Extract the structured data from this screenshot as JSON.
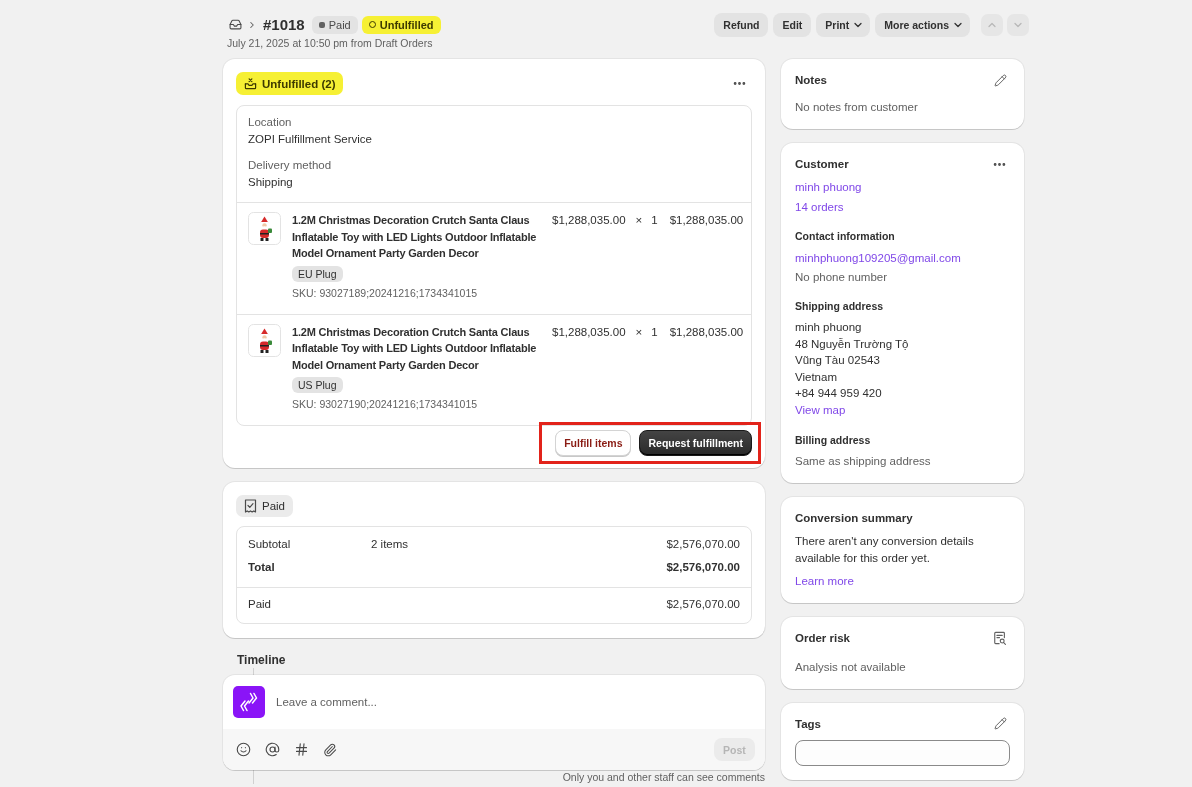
{
  "header": {
    "order_number": "#1018",
    "badges": [
      {
        "label": "Paid",
        "kind": "neutral"
      },
      {
        "label": "Unfulfilled",
        "kind": "attention"
      }
    ],
    "subtitle": "July 21, 2025 at 10:50 pm from Draft Orders",
    "actions": [
      {
        "label": "Refund",
        "has_menu": false
      },
      {
        "label": "Edit",
        "has_menu": false
      },
      {
        "label": "Print",
        "has_menu": true
      },
      {
        "label": "More actions",
        "has_menu": true
      }
    ],
    "nav": [
      {
        "kind": "up",
        "disabled": true
      },
      {
        "kind": "down",
        "disabled": true
      }
    ]
  },
  "fulfillment": {
    "status": "Unfulfilled (2)",
    "location_label": "Location",
    "location": "ZOPI Fulfillment Service",
    "delivery_label": "Delivery method",
    "delivery": "Shipping",
    "items": [
      {
        "title": "1.2M Christmas Decoration Crutch Santa Claus Inflatable Toy with LED Lights Outdoor Inflatable Model Ornament Party Garden Decor",
        "price": "$1,288,035.00",
        "multiply": "×",
        "quantity": "1",
        "total": "$1,288,035.00",
        "variant": "EU Plug",
        "sku": "SKU: 93027189;20241216;1734341015"
      },
      {
        "title": "1.2M Christmas Decoration Crutch Santa Claus Inflatable Toy with LED Lights Outdoor Inflatable Model Ornament Party Garden Decor",
        "price": "$1,288,035.00",
        "multiply": "×",
        "quantity": "1",
        "total": "$1,288,035.00",
        "variant": "US Plug",
        "sku": "SKU: 93027190;20241216;1734341015"
      }
    ],
    "buttons": [
      {
        "label": "Fulfill items",
        "kind": "secondary"
      },
      {
        "label": "Request fulfillment",
        "kind": "primary"
      }
    ],
    "highlighted": true
  },
  "payment": {
    "status": "Paid",
    "sections": [
      {
        "rows": [
          {
            "label": "Subtotal",
            "detail": "2 items",
            "amount": "$2,576,070.00",
            "bold": false
          },
          {
            "label": "Total",
            "amount": "$2,576,070.00",
            "bold": true
          }
        ]
      },
      {
        "rows": [
          {
            "label": "Paid",
            "amount": "$2,576,070.00",
            "bold": false
          }
        ]
      }
    ]
  },
  "timeline": {
    "title": "Timeline",
    "comment_placeholder": "Leave a comment...",
    "post_button": {
      "label": "Post",
      "disabled": true
    },
    "note": "Only you and other staff can see comments"
  },
  "notes": {
    "title": "Notes",
    "text": "No notes from customer"
  },
  "customer": {
    "title": "Customer",
    "name": "minh phuong",
    "orders": "14 orders",
    "contact": {
      "title": "Contact information",
      "email": "minhphuong109205@gmail.com",
      "phone": "No phone number"
    },
    "shipping": {
      "title": "Shipping address",
      "lines": [
        "minh phuong",
        "48 Nguyễn Trường Tộ",
        "Vũng Tàu 02543",
        "Vietnam",
        "+84 944 959 420"
      ],
      "map_link": "View map"
    },
    "billing": {
      "title": "Billing address",
      "text": "Same as shipping address"
    }
  },
  "conversion_summary": {
    "title": "Conversion summary",
    "text": "There aren't any conversion details available for this order yet.",
    "link": "Learn more"
  },
  "order_risk": {
    "title": "Order risk",
    "text": "Analysis not available"
  },
  "tags": {
    "title": "Tags"
  }
}
